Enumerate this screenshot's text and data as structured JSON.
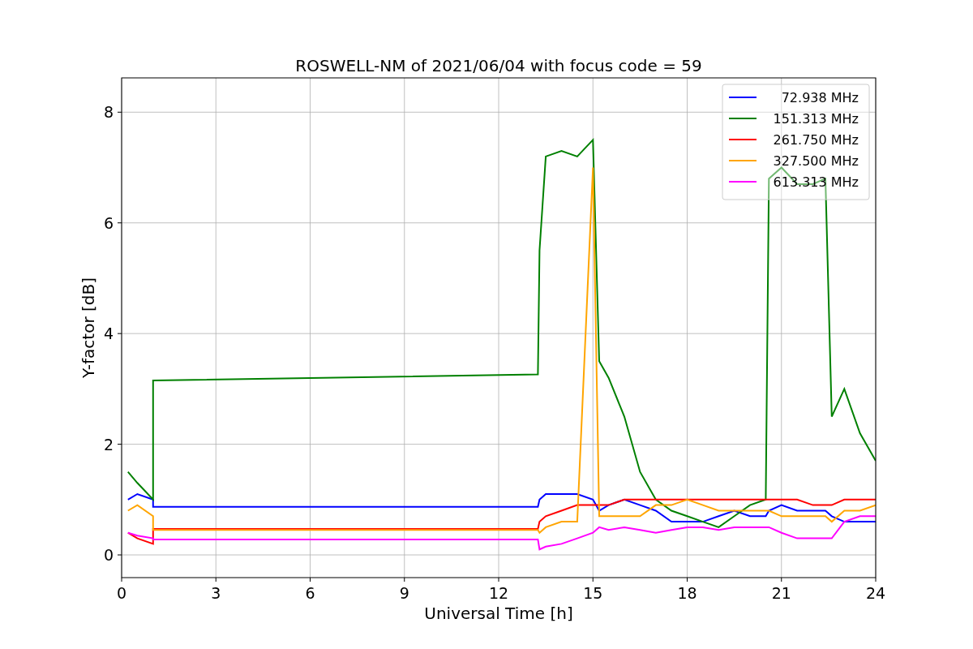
{
  "figure": {
    "chart_data": {
      "type": "line",
      "title": "ROSWELL-NM of 2021/06/04 with focus code = 59",
      "xlabel": "Universal Time [h]",
      "ylabel": "Y-factor [dB]",
      "x": [
        0.2,
        0.5,
        1.0,
        1.0,
        13.25,
        13.3,
        13.5,
        14,
        14.5,
        15,
        15.2,
        15.5,
        16,
        16.5,
        17,
        17.5,
        18,
        18.5,
        19,
        19.5,
        20,
        20.5,
        20.6,
        21,
        21.5,
        22,
        22.4,
        22.6,
        23,
        23.5,
        24
      ],
      "series": [
        {
          "name": "72.938 MHz",
          "color": "#0000ff",
          "values": [
            1.0,
            1.1,
            1.0,
            0.87,
            0.87,
            1.0,
            1.1,
            1.1,
            1.1,
            1.0,
            0.8,
            0.9,
            1.0,
            0.9,
            0.8,
            0.6,
            0.6,
            0.6,
            0.7,
            0.8,
            0.7,
            0.7,
            0.8,
            0.9,
            0.8,
            0.8,
            0.8,
            0.7,
            0.6,
            0.6,
            0.6
          ]
        },
        {
          "name": "151.313 MHz",
          "color": "#008000",
          "values": [
            1.5,
            1.3,
            1.0,
            3.15,
            3.26,
            5.5,
            7.2,
            7.3,
            7.2,
            7.5,
            3.5,
            3.2,
            2.5,
            1.5,
            1.0,
            0.8,
            0.7,
            0.6,
            0.5,
            0.7,
            0.9,
            1.0,
            6.8,
            7.0,
            6.7,
            6.7,
            6.8,
            2.5,
            3.0,
            2.2,
            1.7
          ]
        },
        {
          "name": "261.750 MHz",
          "color": "#ff0000",
          "values": [
            0.4,
            0.3,
            0.2,
            0.47,
            0.47,
            0.6,
            0.7,
            0.8,
            0.9,
            0.9,
            0.9,
            0.9,
            1.0,
            1.0,
            1.0,
            1.0,
            1.0,
            1.0,
            1.0,
            1.0,
            1.0,
            1.0,
            1.0,
            1.0,
            1.0,
            0.9,
            0.9,
            0.9,
            1.0,
            1.0,
            1.0
          ]
        },
        {
          "name": "327.500 MHz",
          "color": "#ffa500",
          "values": [
            0.8,
            0.9,
            0.7,
            0.45,
            0.45,
            0.4,
            0.5,
            0.6,
            0.6,
            7.0,
            0.7,
            0.7,
            0.7,
            0.7,
            0.9,
            0.9,
            1.0,
            0.9,
            0.8,
            0.8,
            0.8,
            0.8,
            0.8,
            0.7,
            0.7,
            0.7,
            0.7,
            0.6,
            0.8,
            0.8,
            0.9
          ]
        },
        {
          "name": "613.313 MHz",
          "color": "#ff00ff",
          "values": [
            0.4,
            0.35,
            0.3,
            0.28,
            0.28,
            0.1,
            0.15,
            0.2,
            0.3,
            0.4,
            0.5,
            0.45,
            0.5,
            0.45,
            0.4,
            0.45,
            0.5,
            0.5,
            0.45,
            0.5,
            0.5,
            0.5,
            0.5,
            0.4,
            0.3,
            0.3,
            0.3,
            0.3,
            0.6,
            0.7,
            0.7
          ]
        }
      ],
      "xlim": [
        0,
        24
      ],
      "ylim": [
        -0.41,
        8.62
      ],
      "xticks": [
        0,
        3,
        6,
        9,
        12,
        15,
        18,
        21,
        24
      ],
      "yticks": [
        0,
        2,
        4,
        6,
        8
      ],
      "grid": true,
      "legend": true
    }
  }
}
